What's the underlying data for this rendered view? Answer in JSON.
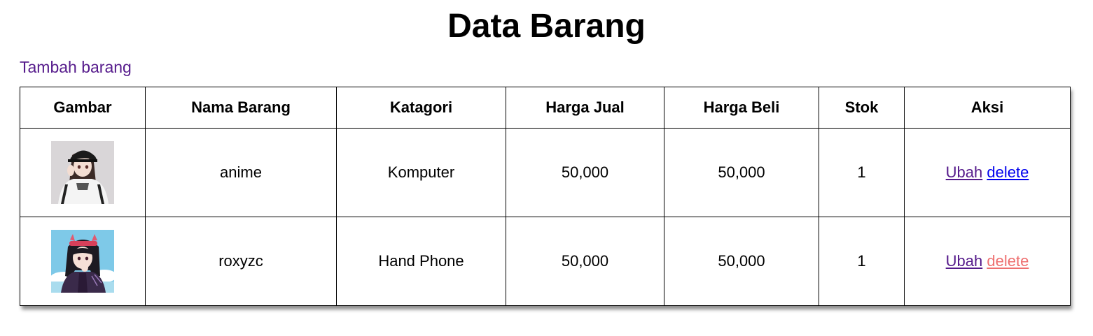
{
  "page": {
    "title": "Data Barang",
    "add_link": "Tambah barang"
  },
  "table": {
    "headers": {
      "gambar": "Gambar",
      "nama": "Nama Barang",
      "kategori": "Katagori",
      "harga_jual": "Harga Jual",
      "harga_beli": "Harga Beli",
      "stok": "Stok",
      "aksi": "Aksi"
    },
    "rows": [
      {
        "image": "anime-girl-cap-thumbnail",
        "nama": "anime",
        "kategori": "Komputer",
        "harga_jual": "50,000",
        "harga_beli": "50,000",
        "stok": "1",
        "edit_label": "Ubah",
        "delete_label": "delete"
      },
      {
        "image": "anime-girl-headband-thumbnail",
        "nama": "roxyzc",
        "kategori": "Hand Phone",
        "harga_jual": "50,000",
        "harga_beli": "50,000",
        "stok": "1",
        "edit_label": "Ubah",
        "delete_label": "delete"
      }
    ]
  },
  "colors": {
    "visited_link": "#551a8b",
    "link": "#0000ee",
    "hover_link": "#ee6f6f"
  }
}
